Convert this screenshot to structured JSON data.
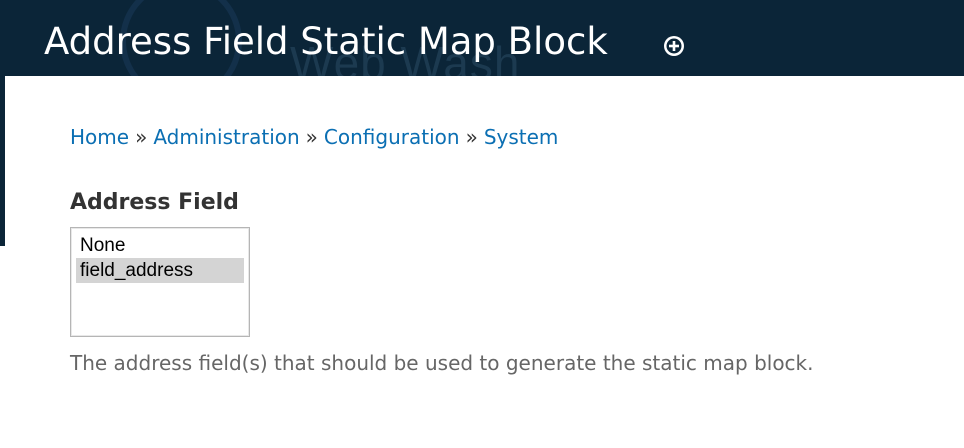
{
  "header": {
    "title": "Address Field Static Map Block",
    "watermark": "Web Wash",
    "shortcut_icon": "plus-circle-icon"
  },
  "breadcrumb": {
    "items": [
      "Home",
      "Administration",
      "Configuration",
      "System"
    ],
    "separator": "»"
  },
  "field": {
    "label": "Address Field",
    "options": [
      "None",
      "field_address"
    ],
    "selected": "field_address",
    "description": "The address field(s) that should be used to generate the static map block."
  },
  "colors": {
    "header_bg": "#0b2538",
    "link": "#0b6fb3",
    "selected_option_bg": "#d4d4d4"
  }
}
